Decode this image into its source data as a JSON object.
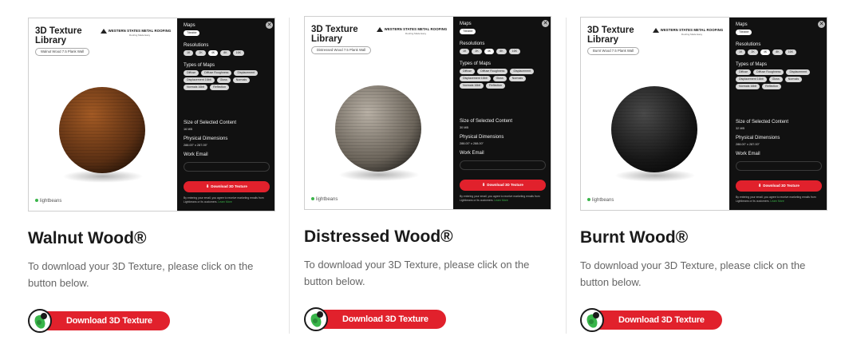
{
  "cards": [
    {
      "library_title": "3D Texture Library",
      "brand": "WESTERN STATES METAL ROOFING",
      "brand_tagline": "Roofing Made Easy",
      "product_chip": "Walnut Wood 7.5 Plank Wall",
      "sphere_color": "#5a2f13",
      "sphere_highlight": "#a35a24",
      "sections": {
        "maps": "Maps",
        "maps_pill": "Tileable",
        "resolutions": "Resolutions",
        "resolution_options": [
          "1K",
          "2K",
          "4K",
          "8K",
          "16K"
        ],
        "types": "Types of Maps",
        "type_options": [
          "Diffuse",
          "Diffuse Roughness",
          "Displacement",
          "Displacement 16bit",
          "Gloss",
          "Normals",
          "Normals 16bit",
          "Reflection"
        ],
        "size": "Size of Selected Content",
        "size_value": "16 MB",
        "dimensions": "Physical Dimensions",
        "dimensions_value": "288.00\" x 287.05\"",
        "email": "Work Email"
      },
      "panel_button": "Download 3D Texture",
      "terms": "By entering your email, you agree to receive marketing emails from Lightbeans or its customers.",
      "terms_link": "Learn More",
      "footer_logo": "lightbeans",
      "title": "Walnut Wood®",
      "description": "To download your 3D Texture, please click on the button below.",
      "cta": "Download 3D Texture"
    },
    {
      "library_title": "3D Texture Library",
      "brand": "WESTERN STATES METAL ROOFING",
      "brand_tagline": "Roofing Made Easy",
      "product_chip": "Distressed Wood 7.5 Plank Wall",
      "sphere_color": "#6b645a",
      "sphere_highlight": "#b8b0a5",
      "sections": {
        "maps": "Maps",
        "maps_pill": "Tileable",
        "resolutions": "Resolutions",
        "resolution_options": [
          "1K",
          "2K",
          "4K",
          "8K",
          "16K"
        ],
        "types": "Types of Maps",
        "type_options": [
          "Diffuse",
          "Diffuse Roughness",
          "Displacement",
          "Displacement 16bit",
          "Gloss",
          "Normals",
          "Normals 16bit",
          "Reflection"
        ],
        "size": "Size of Selected Content",
        "size_value": "30 MB",
        "dimensions": "Physical Dimensions",
        "dimensions_value": "288.00\" x 288.00\"",
        "email": "Work Email"
      },
      "panel_button": "Download 3D Texture",
      "terms": "By entering your email, you agree to receive marketing emails from Lightbeans or its customers.",
      "terms_link": "Learn More",
      "footer_logo": "lightbeans",
      "title": "Distressed Wood®",
      "description": "To download your 3D Texture, please click on the button below.",
      "cta": "Download 3D Texture"
    },
    {
      "library_title": "3D Texture Library",
      "brand": "WESTERN STATES METAL ROOFING",
      "brand_tagline": "Roofing Made Easy",
      "product_chip": "Burnt Wood 7.5 Plank Wall",
      "sphere_color": "#161616",
      "sphere_highlight": "#4a4a4a",
      "sections": {
        "maps": "Maps",
        "maps_pill": "Tileable",
        "resolutions": "Resolutions",
        "resolution_options": [
          "1K",
          "2K",
          "4K",
          "8K",
          "16K"
        ],
        "types": "Types of Maps",
        "type_options": [
          "Diffuse",
          "Diffuse Roughness",
          "Displacement",
          "Displacement 16bit",
          "Gloss",
          "Normals",
          "Normals 16bit",
          "Reflection"
        ],
        "size": "Size of Selected Content",
        "size_value": "32 MB",
        "dimensions": "Physical Dimensions",
        "dimensions_value": "288.00\" x 287.00\"",
        "email": "Work Email"
      },
      "panel_button": "Download 3D Texture",
      "terms": "By entering your email, you agree to receive marketing emails from Lightbeans or its customers.",
      "terms_link": "Learn More",
      "footer_logo": "lightbeans",
      "title": "Burnt Wood®",
      "description": "To download your 3D Texture, please click on the button below.",
      "cta": "Download 3D Texture"
    }
  ],
  "colors": {
    "accent": "#e1212c",
    "panel": "#111111",
    "logo_green": "#39b54a"
  },
  "icons": {
    "close": "close-icon",
    "download": "download-icon",
    "cta_logo": "lightbeans-logo-icon"
  }
}
